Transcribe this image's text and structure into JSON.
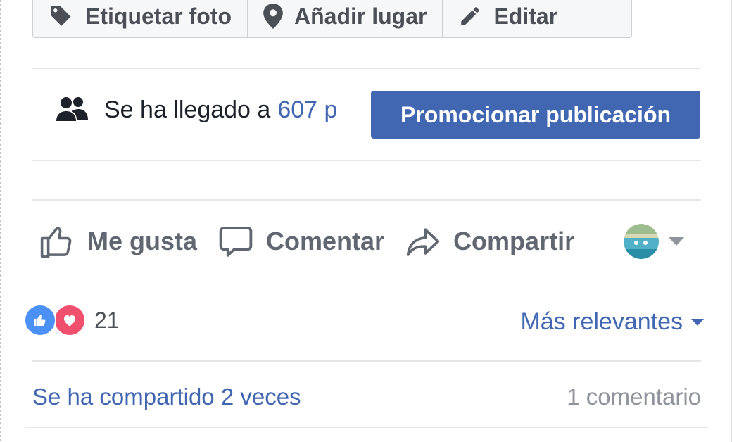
{
  "toolbar": {
    "tag_label": "Etiquetar foto",
    "place_label": "Añadir lugar",
    "edit_label": "Editar"
  },
  "reach": {
    "prefix": "Se ha llegado a",
    "count": "607 p",
    "promote_label": "Promocionar publicación"
  },
  "actions": {
    "like_label": "Me gusta",
    "comment_label": "Comentar",
    "share_label": "Compartir"
  },
  "reactions": {
    "count": "21",
    "sort_label": "Más relevantes"
  },
  "footer": {
    "shares_text": "Se ha compartido 2 veces",
    "comments_text": "1 comentario"
  },
  "colors": {
    "brand_blue": "#4267b2",
    "like_blue": "#4a90f5",
    "love_red": "#f0506e",
    "text_gray": "#4b4f56",
    "muted_gray": "#90949c"
  },
  "icons": [
    "tag-icon",
    "map-pin-icon",
    "pencil-icon",
    "people-icon",
    "like-thumb-icon",
    "comment-bubble-icon",
    "share-arrow-icon",
    "avatar",
    "chevron-down-icon",
    "like-reaction-icon",
    "love-reaction-icon"
  ]
}
